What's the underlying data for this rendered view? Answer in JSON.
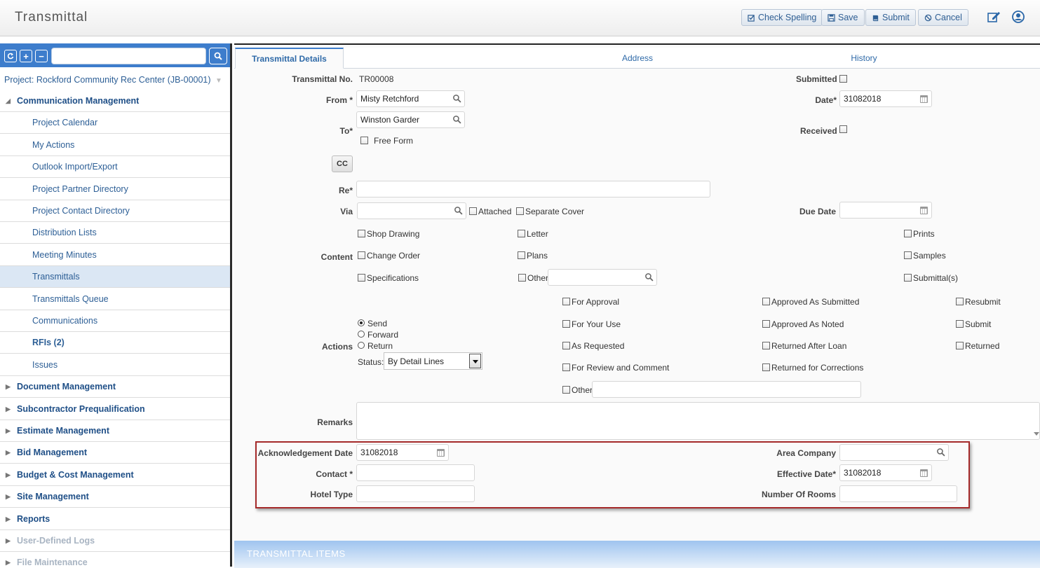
{
  "app": {
    "title": "Transmittal"
  },
  "toolbar": {
    "check_spelling": "Check Spelling",
    "save": "Save",
    "submit": "Submit",
    "cancel": "Cancel",
    "edit_icon": "edit-icon",
    "user_icon": "user-circle-icon"
  },
  "sidebar": {
    "project": "Project: Rockford Community Rec Center (JB-00001)",
    "search_placeholder": "",
    "items": [
      {
        "label": "Communication Management",
        "type": "section",
        "expanded": true
      },
      {
        "label": "Project Calendar",
        "type": "item"
      },
      {
        "label": "My Actions",
        "type": "item"
      },
      {
        "label": "Outlook Import/Export",
        "type": "item"
      },
      {
        "label": "Project Partner Directory",
        "type": "item"
      },
      {
        "label": "Project Contact Directory",
        "type": "item"
      },
      {
        "label": "Distribution Lists",
        "type": "item"
      },
      {
        "label": "Meeting Minutes",
        "type": "item"
      },
      {
        "label": "Transmittals",
        "type": "item",
        "active": true
      },
      {
        "label": "Transmittals Queue",
        "type": "item"
      },
      {
        "label": "Communications",
        "type": "item"
      },
      {
        "label": "RFIs (2)",
        "type": "item"
      },
      {
        "label": "Issues",
        "type": "item"
      },
      {
        "label": "Document Management",
        "type": "section"
      },
      {
        "label": "Subcontractor Prequalification",
        "type": "section"
      },
      {
        "label": "Estimate Management",
        "type": "section"
      },
      {
        "label": "Bid Management",
        "type": "section"
      },
      {
        "label": "Budget & Cost Management",
        "type": "section"
      },
      {
        "label": "Site Management",
        "type": "section"
      },
      {
        "label": "Reports",
        "type": "section"
      },
      {
        "label": "User-Defined Logs",
        "type": "section",
        "disabled": true
      },
      {
        "label": "File Maintenance",
        "type": "section",
        "disabled": true
      }
    ]
  },
  "tabs": [
    {
      "label": "Transmittal Details",
      "active": true
    },
    {
      "label": "Address"
    },
    {
      "label": "History"
    }
  ],
  "form": {
    "transmittal_no_label": "Transmittal No.",
    "transmittal_no": "TR00008",
    "submitted_label": "Submitted",
    "from_label": "From *",
    "from_value": "Misty Retchford",
    "date_label": "Date*",
    "date_value": "31082018",
    "to_label": "To*",
    "to_value": "Winston Garder",
    "received_label": "Received",
    "free_form_label": "Free Form",
    "cc_label": "CC",
    "re_label": "Re*",
    "re_value": "",
    "via_label": "Via",
    "via_value": "",
    "attached_label": "Attached",
    "separate_cover_label": "Separate Cover",
    "due_date_label": "Due Date",
    "due_date_value": "",
    "content_label": "Content",
    "content_options": {
      "shop_drawing": "Shop Drawing",
      "change_order": "Change Order",
      "specifications": "Specifications",
      "letter": "Letter",
      "plans": "Plans",
      "other": "Other",
      "prints": "Prints",
      "samples": "Samples",
      "submittals": "Submittal(s)"
    },
    "actions_label": "Actions",
    "radios": {
      "send": "Send",
      "forward": "Forward",
      "return": "Return",
      "selected": "Send"
    },
    "status_label": "Status:",
    "status_value": "By Detail Lines",
    "action_options": {
      "for_approval": "For Approval",
      "for_your_use": "For Your Use",
      "as_requested": "As Requested",
      "for_review": "For Review and Comment",
      "other": "Other",
      "approved_as_submitted": "Approved As Submitted",
      "approved_as_noted": "Approved As Noted",
      "returned_after_loan": "Returned After Loan",
      "returned_for_corrections": "Returned for Corrections",
      "resubmit": "Resubmit",
      "submit": "Submit",
      "returned": "Returned"
    },
    "remarks_label": "Remarks",
    "remarks_value": "",
    "ack_date_label": "Acknowledgement Date",
    "ack_date_value": "31082018",
    "contact_label": "Contact *",
    "contact_value": "",
    "hotel_type_label": "Hotel Type",
    "hotel_type_value": "",
    "area_company_label": "Area Company",
    "area_company_value": "",
    "effective_date_label": "Effective Date*",
    "effective_date_value": "31082018",
    "number_of_rooms_label": "Number Of Rooms",
    "number_of_rooms_value": ""
  },
  "items_section": {
    "title": "TRANSMITTAL ITEMS"
  },
  "colors": {
    "accent": "#3d7dcc",
    "link": "#2d5f96",
    "highlight_border": "#a52a2a"
  }
}
